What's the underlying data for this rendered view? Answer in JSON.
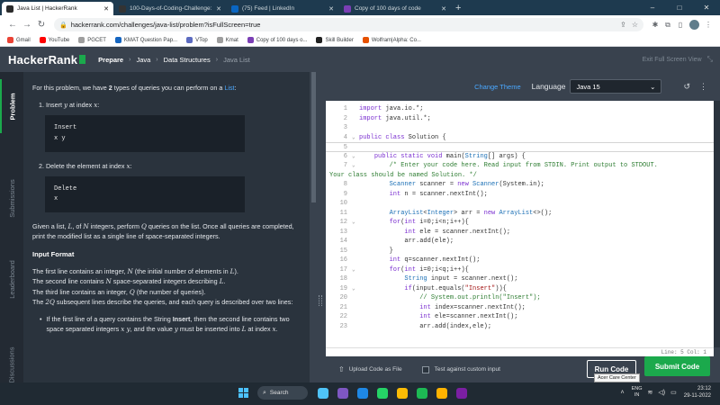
{
  "browser": {
    "tabs": [
      {
        "label": "Java List | HackerRank",
        "color": "#2b2b2b",
        "active": true
      },
      {
        "label": "100-Days-of-Coding-Challenge:",
        "color": "#333333",
        "active": false
      },
      {
        "label": "(75) Feed | LinkedIn",
        "color": "#0a66c2",
        "active": false
      },
      {
        "label": "Copy of 100 days of code",
        "color": "#7b3fb5",
        "active": false
      }
    ],
    "url": "hackerrank.com/challenges/java-list/problem?isFullScreen=true",
    "bookmarks": [
      {
        "label": "Gmail",
        "color": "#ea4335"
      },
      {
        "label": "YouTube",
        "color": "#ff0000"
      },
      {
        "label": "PGCET",
        "color": "#9e9e9e"
      },
      {
        "label": "KMAT Question Pap...",
        "color": "#1565c0"
      },
      {
        "label": "VTop",
        "color": "#5c6bc0"
      },
      {
        "label": "Kmat",
        "color": "#9e9e9e"
      },
      {
        "label": "Copy of 100 days o...",
        "color": "#7b3fb5"
      },
      {
        "label": "Skill Builder",
        "color": "#212121"
      },
      {
        "label": "Wolfram|Alpha: Co...",
        "color": "#e65100"
      }
    ]
  },
  "header": {
    "logo": "HackerRank",
    "crumbs": [
      "Prepare",
      "Java",
      "Data Structures",
      "Java List"
    ],
    "exit_label": "Exit Full Screen View"
  },
  "sidetabs": [
    "Problem",
    "Submissions",
    "Leaderboard",
    "Discussions"
  ],
  "problem": {
    "intro_pre": "For this problem, we have ",
    "intro_num": "2",
    "intro_mid": " types of queries you can perform on a ",
    "intro_link": "List",
    "intro_post": ":",
    "item1_pre": "1. Insert ",
    "item1_y": "y",
    "item1_mid": " at index ",
    "item1_x": "x",
    "item1_post": ":",
    "code1_l1": "Insert",
    "code1_l2": "x y",
    "item2_pre": "2. Delete the element at index ",
    "item2_x": "x",
    "item2_post": ":",
    "code2_l1": "Delete",
    "code2_l2": "x",
    "given_1": "Given a list, ",
    "given_L": "L",
    "given_2": ", of ",
    "given_N": "N",
    "given_3": " integers, perform ",
    "given_Q": "Q",
    "given_4": " queries on the list. Once all queries are completed, print the modified list as a single line of space-separated integers.",
    "input_heading": "Input Format",
    "in1_pre": "The first line contains an integer, ",
    "in1_N": "N",
    "in1_mid": " (the initial number of elements in ",
    "in1_L": "L",
    "in1_post": ").",
    "in2_pre": "The second line contains ",
    "in2_N": "N",
    "in2_mid": " space-separated integers describing ",
    "in2_L": "L",
    "in2_post": ".",
    "in3_pre": "The third line contains an integer, ",
    "in3_Q": "Q",
    "in3_post": " (the number of queries).",
    "in4_pre": "The ",
    "in4_2Q": "2Q",
    "in4_post": " subsequent lines describe the queries, and each query is described over two lines:",
    "b1_pre": "If the first line of a query contains the String ",
    "b1_bold": "Insert",
    "b1_mid": ", then the second line contains two space separated integers ",
    "b1_xy": "x y",
    "b1_mid2": ", and the value ",
    "b1_y": "y",
    "b1_mid3": " must be inserted into ",
    "b1_L": "L",
    "b1_mid4": " at index ",
    "b1_x": "x",
    "b1_post": "."
  },
  "editor": {
    "change_theme": "Change Theme",
    "language_label": "Language",
    "language": "Java 15",
    "status": "Line: 5 Col: 1",
    "upload": "Upload Code as File",
    "custom_input": "Test against custom input",
    "run": "Run Code",
    "submit": "Submit Code",
    "tooltip": "Acer Care Center",
    "lines": [
      {
        "n": "1",
        "html": "<span class=\"kw\">import</span> java.io.*;"
      },
      {
        "n": "2",
        "html": "<span class=\"kw\">import</span> java.util.*;"
      },
      {
        "n": "3",
        "html": ""
      },
      {
        "n": "4",
        "html": "<span class=\"kw\">public class</span> Solution {",
        "fold": true
      },
      {
        "n": "5",
        "html": "",
        "current": true
      },
      {
        "n": "6",
        "html": "    <span class=\"kw\">public static void</span> main(<span class=\"ty\">String</span>[] args) {",
        "fold": true
      },
      {
        "n": "7",
        "html": "        <span class=\"cm\">/* Enter your code here. Read input from STDIN. Print output to STDOUT.</span>",
        "fold": true
      },
      {
        "n": "",
        "html": "<span class=\"cm\">Your class should be named Solution. */</span>",
        "wrapped": true
      },
      {
        "n": "8",
        "html": "        <span class=\"ty\">Scanner</span> scanner = <span class=\"kw\">new</span> <span class=\"ty\">Scanner</span>(System.in);"
      },
      {
        "n": "9",
        "html": "        <span class=\"kw\">int</span> n = scanner.nextInt();"
      },
      {
        "n": "10",
        "html": ""
      },
      {
        "n": "11",
        "html": "        <span class=\"ty\">ArrayList</span>&lt;<span class=\"ty\">Integer</span>&gt; arr = <span class=\"kw\">new</span> <span class=\"ty\">ArrayList</span>&lt;&gt;();"
      },
      {
        "n": "12",
        "html": "        <span class=\"kw\">for</span>(<span class=\"kw\">int</span> i=0;i&lt;n;i++){",
        "fold": true
      },
      {
        "n": "13",
        "html": "            <span class=\"kw\">int</span> ele = scanner.nextInt();"
      },
      {
        "n": "14",
        "html": "            arr.add(ele);"
      },
      {
        "n": "15",
        "html": "        }"
      },
      {
        "n": "16",
        "html": "        <span class=\"kw\">int</span> q=scanner.nextInt();"
      },
      {
        "n": "17",
        "html": "        <span class=\"kw\">for</span>(<span class=\"kw\">int</span> i=0;i&lt;q;i++){",
        "fold": true
      },
      {
        "n": "18",
        "html": "            <span class=\"ty\">String</span> input = scanner.next();"
      },
      {
        "n": "19",
        "html": "            <span class=\"kw\">if</span>(input.equals(<span class=\"st\">\"Insert\"</span>)){",
        "fold": true
      },
      {
        "n": "20",
        "html": "                <span class=\"cm\">// System.out.println(\"Insert\");</span>"
      },
      {
        "n": "21",
        "html": "                <span class=\"kw\">int</span> index=scanner.nextInt();"
      },
      {
        "n": "22",
        "html": "                <span class=\"kw\">int</span> ele=scanner.nextInt();"
      },
      {
        "n": "23",
        "html": "                arr.add(index,ele);"
      }
    ]
  },
  "taskbar": {
    "search": "Search",
    "apps": [
      "#4fc3f7",
      "#7e57c2",
      "#1e88e5",
      "#25d366",
      "#fbbc05",
      "#1db954",
      "#ffb300",
      "#7b1fa2"
    ],
    "lang_top": "ENG",
    "lang_bottom": "IN",
    "time": "23:12",
    "date": "29-11-2022"
  }
}
